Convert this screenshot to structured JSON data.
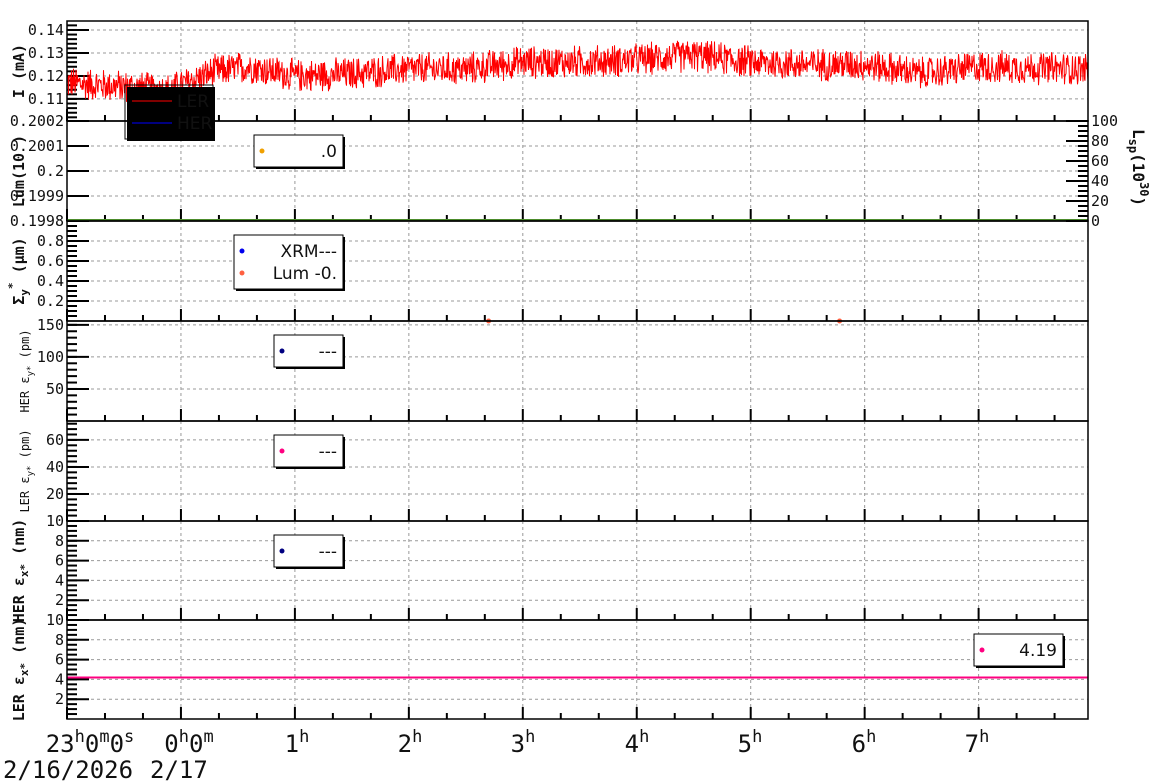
{
  "chart_data": {
    "type": "line",
    "x_unit": "hours since 2/16/2026 23:00",
    "xlim": [
      0,
      8.96
    ],
    "x_ticks": [
      {
        "h": 0,
        "label_main": "23",
        "label_parts": [
          "h",
          "0",
          "m",
          "0",
          "s"
        ],
        "date": "2/16/2026"
      },
      {
        "h": 1,
        "label_main": "0",
        "label_parts": [
          "h",
          "0",
          "m"
        ],
        "date": "2/17"
      },
      {
        "h": 2,
        "label_main": "1",
        "label_parts": [
          "h"
        ]
      },
      {
        "h": 3,
        "label_main": "2",
        "label_parts": [
          "h"
        ]
      },
      {
        "h": 4,
        "label_main": "3",
        "label_parts": [
          "h"
        ]
      },
      {
        "h": 5,
        "label_main": "4",
        "label_parts": [
          "h"
        ]
      },
      {
        "h": 6,
        "label_main": "5",
        "label_parts": [
          "h"
        ]
      },
      {
        "h": 7,
        "label_main": "6",
        "label_parts": [
          "h"
        ]
      },
      {
        "h": 8,
        "label_main": "7",
        "label_parts": [
          "h"
        ]
      }
    ],
    "panels": [
      {
        "id": "current",
        "ylabel": {
          "main": "I (mA)",
          "bold": true
        },
        "ylim": [
          0.1004,
          0.1439
        ],
        "yticks": [
          0.11,
          0.12,
          0.13,
          0.14
        ],
        "ytick_labels": [
          "0.11",
          "0.12",
          "0.13",
          "0.14"
        ],
        "minor_step": 0.002,
        "series": [
          {
            "name": "LER",
            "color": "#ff0000",
            "noise": 0.008,
            "trend_x": [
              0,
              0.3,
              0.9,
              1.3,
              1.6,
              2.0,
              2.5,
              3.0,
              3.5,
              4.0,
              4.5,
              5.0,
              5.5,
              6.0,
              6.5,
              7.0,
              7.5,
              8.0,
              8.96
            ],
            "trend_y": [
              0.117,
              0.116,
              0.114,
              0.122,
              0.124,
              0.12,
              0.121,
              0.123,
              0.123,
              0.126,
              0.126,
              0.127,
              0.129,
              0.126,
              0.125,
              0.125,
              0.121,
              0.124,
              0.123
            ]
          },
          {
            "name": "HER",
            "color": "#0000ff",
            "values": []
          }
        ],
        "legend": [
          {
            "label": "LER",
            "color": "#ff0000"
          },
          {
            "label": "HER",
            "color": "#0000ff"
          }
        ]
      },
      {
        "id": "luminosity",
        "ylabel": {
          "main": "Lum(10",
          "tail": " )",
          "bold": true
        },
        "ylim": [
          0.1998,
          0.2002
        ],
        "yticks": [
          0.1998,
          0.1999,
          0.2,
          0.2001,
          0.2002
        ],
        "ytick_labels": [
          "0.1998",
          "0.1999",
          "0.2",
          "0.2001",
          "0.2002"
        ],
        "right_axis": {
          "label_main": "L",
          "label_sub": "sp",
          "label_rest": "(10",
          "label_sup": "30",
          "label_close": ")",
          "ylim": [
            0,
            100
          ],
          "yticks": [
            0,
            20,
            40,
            60,
            80,
            100
          ],
          "ytick_labels": [
            "0",
            "20",
            "40",
            "60",
            "80",
            "100"
          ]
        },
        "baseline_color": "#4c8c2c",
        "legend": [
          {
            "label": ".0",
            "color": "#f0a000"
          }
        ]
      },
      {
        "id": "sigma-y",
        "ylabel": {
          "main": "Σ",
          "sub": "y",
          "sup": "*",
          "unit": " (μm)",
          "bold": true
        },
        "ylim": [
          0,
          1
        ],
        "yticks": [
          0.2,
          0.4,
          0.6,
          0.8
        ],
        "ytick_labels": [
          "0.2",
          "0.4",
          "0.6",
          "0.8"
        ],
        "minor_step": 0.05,
        "points": [
          {
            "x": 3.7,
            "y": 0,
            "color": "#ff6040"
          },
          {
            "x": 6.78,
            "y": 0,
            "color": "#ff6040"
          }
        ],
        "legend": [
          {
            "label": "XRM---",
            "color": "#0000ee"
          },
          {
            "label": "Lum -0.",
            "color": "#ff6040"
          }
        ]
      },
      {
        "id": "her-emit-y",
        "ylabel": {
          "main": "HER ε",
          "sub": "y*",
          "unit": " (pm)",
          "bold": false
        },
        "ylim": [
          0,
          156
        ],
        "yticks": [
          50,
          100,
          150
        ],
        "ytick_labels": [
          "50",
          "100",
          "150"
        ],
        "minor_step": 10,
        "legend": [
          {
            "label": "---",
            "color": "#000080"
          }
        ]
      },
      {
        "id": "ler-emit-y",
        "ylabel": {
          "main": "LER ε",
          "sub": "y*",
          "unit": " (pm)",
          "bold": false
        },
        "ylim": [
          0,
          74
        ],
        "yticks": [
          20,
          40,
          60
        ],
        "ytick_labels": [
          "20",
          "40",
          "60"
        ],
        "minor_step": 4,
        "legend": [
          {
            "label": "---",
            "color": "#ff0080"
          }
        ]
      },
      {
        "id": "her-emit-x",
        "ylabel": {
          "main": "HER ε",
          "sub": "x*",
          "unit": " (nm)",
          "bold": true
        },
        "ylim": [
          0,
          10
        ],
        "yticks": [
          2,
          4,
          6,
          8,
          10
        ],
        "ytick_labels": [
          "2",
          "4",
          "6",
          "8",
          "10"
        ],
        "minor_step": 0.5,
        "legend": [
          {
            "label": "---",
            "color": "#000080"
          }
        ]
      },
      {
        "id": "ler-emit-x",
        "ylabel": {
          "main": "LER ε",
          "sub": "x*",
          "unit": " (nm)",
          "bold": true
        },
        "ylim": [
          0,
          10
        ],
        "yticks": [
          2,
          4,
          6,
          8,
          10
        ],
        "ytick_labels": [
          "2",
          "4",
          "6",
          "8",
          "10"
        ],
        "minor_step": 0.5,
        "hline": {
          "y": 4.19,
          "color": "#ff0080"
        },
        "legend": [
          {
            "label": "4.19",
            "color": "#ff0080"
          }
        ]
      }
    ]
  }
}
